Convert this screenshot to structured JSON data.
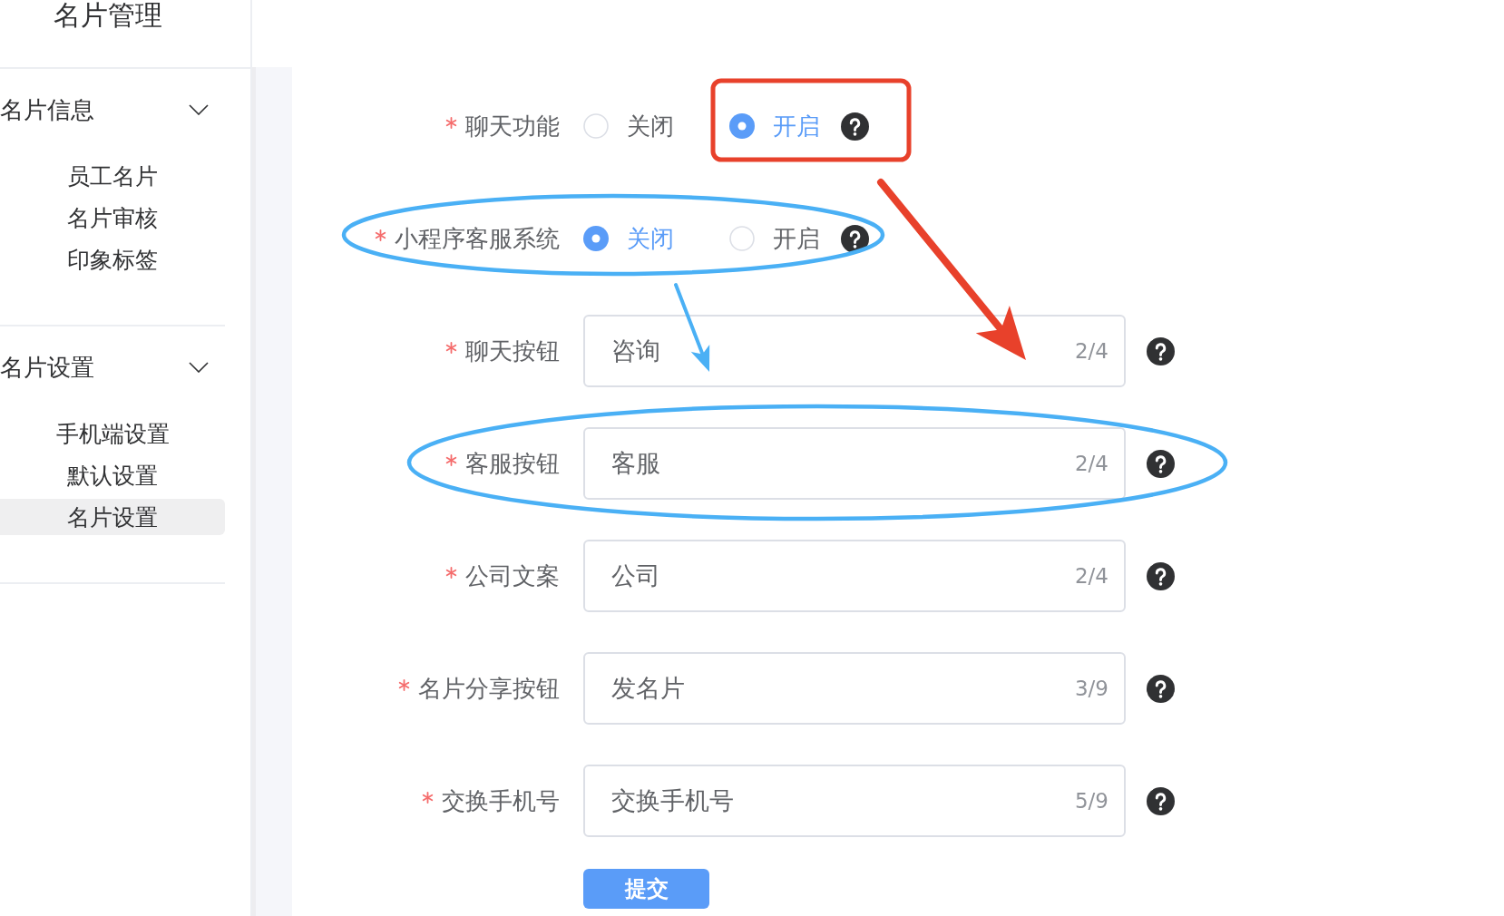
{
  "sidebar": {
    "title": "名片管理",
    "groups": [
      {
        "title": "名片信息",
        "expanded": true,
        "items": [
          {
            "label": "员工名片",
            "selected": false
          },
          {
            "label": "名片审核",
            "selected": false
          },
          {
            "label": "印象标签",
            "selected": false
          }
        ]
      },
      {
        "title": "名片设置",
        "expanded": true,
        "items": [
          {
            "label": "手机端设置",
            "selected": false
          },
          {
            "label": "默认设置",
            "selected": false
          },
          {
            "label": "名片设置",
            "selected": true
          }
        ]
      }
    ]
  },
  "form": {
    "fields": [
      {
        "kind": "radio",
        "label": "聊天功能",
        "required": true,
        "help": true,
        "options": [
          {
            "label": "关闭",
            "selected": false
          },
          {
            "label": "开启",
            "selected": true
          }
        ]
      },
      {
        "kind": "radio",
        "label": "小程序客服系统",
        "required": true,
        "help": true,
        "options": [
          {
            "label": "关闭",
            "selected": true
          },
          {
            "label": "开启",
            "selected": false
          }
        ]
      },
      {
        "kind": "text",
        "label": "聊天按钮",
        "required": true,
        "help": true,
        "value": "咨询",
        "counter": "2/4"
      },
      {
        "kind": "text",
        "label": "客服按钮",
        "required": true,
        "help": true,
        "value": "客服",
        "counter": "2/4"
      },
      {
        "kind": "text",
        "label": "公司文案",
        "required": true,
        "help": true,
        "value": "公司",
        "counter": "2/4"
      },
      {
        "kind": "text",
        "label": "名片分享按钮",
        "required": true,
        "help": true,
        "value": "发名片",
        "counter": "3/9"
      },
      {
        "kind": "text",
        "label": "交换手机号",
        "required": true,
        "help": true,
        "value": "交换手机号",
        "counter": "5/9"
      }
    ],
    "submit": {
      "label": "提交"
    }
  },
  "annotations": [
    {
      "kind": "rectangle",
      "color": "#e8412b"
    },
    {
      "kind": "arrow",
      "color": "#e8412b"
    },
    {
      "kind": "ellipse",
      "color": "#4ab0f5"
    },
    {
      "kind": "arrow",
      "color": "#4ab0f5"
    },
    {
      "kind": "ellipse",
      "color": "#4ab0f5"
    }
  ]
}
